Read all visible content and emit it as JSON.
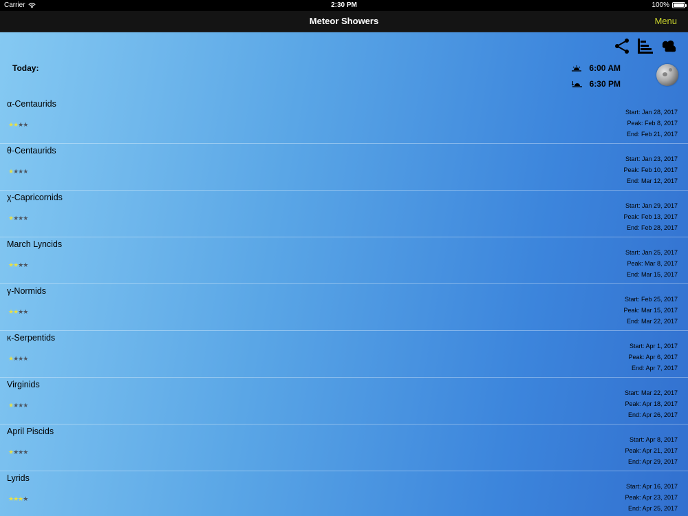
{
  "status_bar": {
    "carrier": "Carrier",
    "time": "2:30 PM",
    "battery": "100%"
  },
  "nav": {
    "title": "Meteor Showers",
    "menu_label": "Menu",
    "menu_color": "#c8d22c"
  },
  "toolbar": {
    "icons": [
      "share-icon",
      "timeline-icon",
      "cloud-icon"
    ]
  },
  "today": {
    "label": "Today:",
    "sunrise": "6:00 AM",
    "sunset": "6:30 PM",
    "moon_icon": "moon-phase-icon"
  },
  "showers": [
    {
      "name": "α-Centaurids",
      "stars": 2,
      "start": "Start: Jan 28, 2017",
      "peak": "Peak: Feb 8, 2017",
      "end": "End: Feb 21, 2017"
    },
    {
      "name": "θ-Centaurids",
      "stars": 1,
      "start": "Start: Jan 23, 2017",
      "peak": "Peak: Feb 10, 2017",
      "end": "End: Mar 12, 2017"
    },
    {
      "name": "χ-Capricornids",
      "stars": 1,
      "start": "Start: Jan 29, 2017",
      "peak": "Peak: Feb 13, 2017",
      "end": "End: Feb 28, 2017"
    },
    {
      "name": "March Lyncids",
      "stars": 2,
      "start": "Start: Jan 25, 2017",
      "peak": "Peak: Mar 8, 2017",
      "end": "End: Mar 15, 2017"
    },
    {
      "name": "γ-Normids",
      "stars": 2,
      "start": "Start: Feb 25, 2017",
      "peak": "Peak: Mar 15, 2017",
      "end": "End: Mar 22, 2017"
    },
    {
      "name": "κ-Serpentids",
      "stars": 1,
      "start": "Start: Apr 1, 2017",
      "peak": "Peak: Apr 6, 2017",
      "end": "End: Apr 7, 2017"
    },
    {
      "name": "Virginids",
      "stars": 1,
      "start": "Start: Mar 22, 2017",
      "peak": "Peak: Apr 18, 2017",
      "end": "End: Apr 26, 2017"
    },
    {
      "name": "April Piscids",
      "stars": 1,
      "start": "Start: Apr 8, 2017",
      "peak": "Peak: Apr 21, 2017",
      "end": "End: Apr 29, 2017"
    },
    {
      "name": "Lyrids",
      "stars": 3,
      "start": "Start: Apr 16, 2017",
      "peak": "Peak: Apr 23, 2017",
      "end": "End: Apr 25, 2017"
    }
  ],
  "max_stars": 4
}
